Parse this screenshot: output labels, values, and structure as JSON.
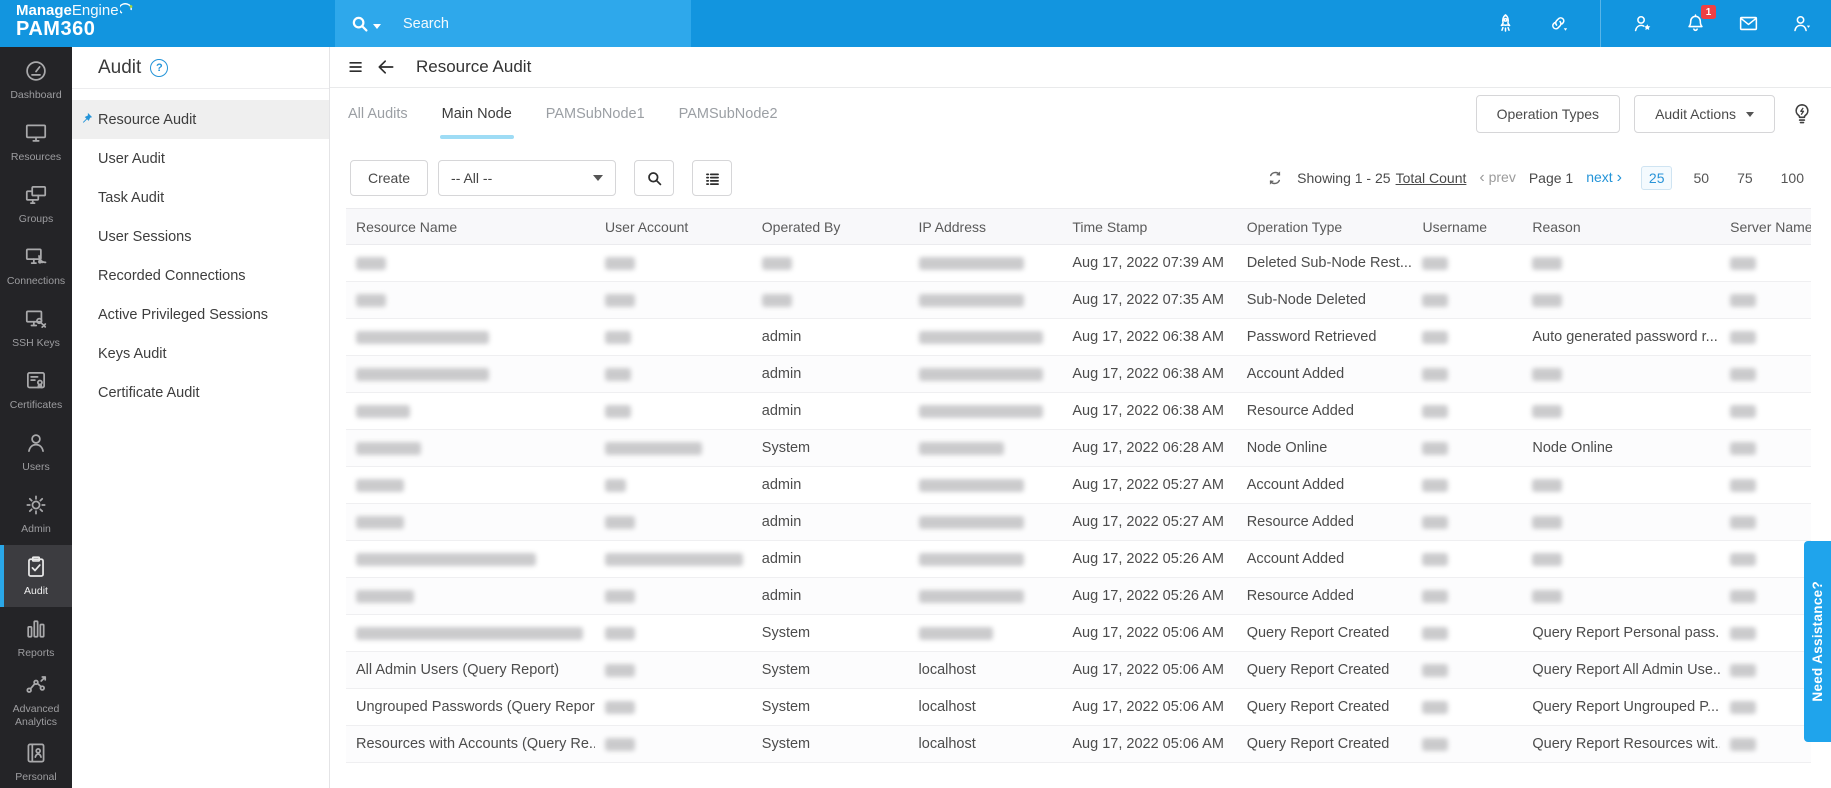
{
  "brand": {
    "manage": "Manage",
    "engine": "Engine",
    "product": "PAM360"
  },
  "topbar": {
    "search_placeholder": "Search",
    "icons": [
      "rocket",
      "link",
      "divider",
      "user-star",
      "bell",
      "mail",
      "user-profile"
    ],
    "notification_badge": "1"
  },
  "sidebar": {
    "items": [
      {
        "label": "Dashboard",
        "icon": "dashboard",
        "active": false
      },
      {
        "label": "Resources",
        "icon": "resources",
        "active": false
      },
      {
        "label": "Groups",
        "icon": "groups",
        "active": false
      },
      {
        "label": "Connections",
        "icon": "connections",
        "active": false
      },
      {
        "label": "SSH Keys",
        "icon": "ssh-keys",
        "active": false
      },
      {
        "label": "Certificates",
        "icon": "certificates",
        "active": false
      },
      {
        "label": "Users",
        "icon": "users",
        "active": false
      },
      {
        "label": "Admin",
        "icon": "admin",
        "active": false
      },
      {
        "label": "Audit",
        "icon": "audit",
        "active": true
      },
      {
        "label": "Reports",
        "icon": "reports",
        "active": false
      },
      {
        "label": "Advanced Analytics",
        "icon": "advanced-analytics",
        "active": false
      },
      {
        "label": "Personal",
        "icon": "personal",
        "active": false
      }
    ]
  },
  "submenu": {
    "title": "Audit",
    "items": [
      {
        "label": "Resource Audit",
        "active": true
      },
      {
        "label": "User Audit",
        "active": false
      },
      {
        "label": "Task Audit",
        "active": false
      },
      {
        "label": "User Sessions",
        "active": false
      },
      {
        "label": "Recorded Connections",
        "active": false
      },
      {
        "label": "Active Privileged Sessions",
        "active": false
      },
      {
        "label": "Keys Audit",
        "active": false
      },
      {
        "label": "Certificate Audit",
        "active": false
      }
    ]
  },
  "page": {
    "title": "Resource Audit"
  },
  "tabs": [
    {
      "label": "All Audits",
      "active": false
    },
    {
      "label": "Main Node",
      "active": true
    },
    {
      "label": "PAMSubNode1",
      "active": false
    },
    {
      "label": "PAMSubNode2",
      "active": false
    }
  ],
  "actions": {
    "operation_types": "Operation Types",
    "audit_actions": "Audit Actions"
  },
  "toolbar": {
    "create_label": "Create",
    "filter_value": "-- All --"
  },
  "pagination": {
    "showing": "Showing 1 - 25",
    "total_count": "Total Count",
    "prev": "prev",
    "page": "Page 1",
    "next": "next",
    "sizes": [
      "25",
      "50",
      "75",
      "100"
    ],
    "active_size": "25"
  },
  "table": {
    "columns": [
      "Resource Name",
      "User Account",
      "Operated By",
      "IP Address",
      "Time Stamp",
      "Operation Type",
      "Username",
      "Reason",
      "Server Name"
    ],
    "rows": [
      [
        {
          "b": 30
        },
        {
          "b": 30
        },
        {
          "b": 30
        },
        {
          "b": 105
        },
        {
          "t": "Aug 17, 2022 07:39 AM"
        },
        {
          "t": "Deleted Sub-Node Rest..."
        },
        {
          "b": 26
        },
        {
          "b": 30
        },
        {
          "b": 26
        }
      ],
      [
        {
          "b": 30
        },
        {
          "b": 30
        },
        {
          "b": 30
        },
        {
          "b": 105
        },
        {
          "t": "Aug 17, 2022 07:35 AM"
        },
        {
          "t": "Sub-Node Deleted"
        },
        {
          "b": 26
        },
        {
          "b": 30
        },
        {
          "b": 26
        }
      ],
      [
        {
          "b": 133
        },
        {
          "b": 26
        },
        {
          "t": "admin"
        },
        {
          "b": 124
        },
        {
          "t": "Aug 17, 2022 06:38 AM"
        },
        {
          "t": "Password Retrieved"
        },
        {
          "b": 26
        },
        {
          "t": "Auto generated password r..."
        },
        {
          "b": 26
        }
      ],
      [
        {
          "b": 133
        },
        {
          "b": 26
        },
        {
          "t": "admin"
        },
        {
          "b": 124
        },
        {
          "t": "Aug 17, 2022 06:38 AM"
        },
        {
          "t": "Account Added"
        },
        {
          "b": 26
        },
        {
          "b": 30
        },
        {
          "b": 26
        }
      ],
      [
        {
          "b": 54
        },
        {
          "b": 26
        },
        {
          "t": "admin"
        },
        {
          "b": 124
        },
        {
          "t": "Aug 17, 2022 06:38 AM"
        },
        {
          "t": "Resource Added"
        },
        {
          "b": 26
        },
        {
          "b": 30
        },
        {
          "b": 26
        }
      ],
      [
        {
          "b": 65
        },
        {
          "b": 97
        },
        {
          "t": "System"
        },
        {
          "b": 85
        },
        {
          "t": "Aug 17, 2022 06:28 AM"
        },
        {
          "t": "Node Online"
        },
        {
          "b": 26
        },
        {
          "t": "Node Online"
        },
        {
          "b": 26
        }
      ],
      [
        {
          "b": 48
        },
        {
          "b": 21
        },
        {
          "t": "admin"
        },
        {
          "b": 105
        },
        {
          "t": "Aug 17, 2022 05:27 AM"
        },
        {
          "t": "Account Added"
        },
        {
          "b": 26
        },
        {
          "b": 30
        },
        {
          "b": 26
        }
      ],
      [
        {
          "b": 48
        },
        {
          "b": 30
        },
        {
          "t": "admin"
        },
        {
          "b": 105
        },
        {
          "t": "Aug 17, 2022 05:27 AM"
        },
        {
          "t": "Resource Added"
        },
        {
          "b": 26
        },
        {
          "b": 30
        },
        {
          "b": 26
        }
      ],
      [
        {
          "b": 180
        },
        {
          "b": 138
        },
        {
          "t": "admin"
        },
        {
          "b": 105
        },
        {
          "t": "Aug 17, 2022 05:26 AM"
        },
        {
          "t": "Account Added"
        },
        {
          "b": 26
        },
        {
          "b": 30
        },
        {
          "b": 26
        }
      ],
      [
        {
          "b": 58
        },
        {
          "b": 30
        },
        {
          "t": "admin"
        },
        {
          "b": 105
        },
        {
          "t": "Aug 17, 2022 05:26 AM"
        },
        {
          "t": "Resource Added"
        },
        {
          "b": 26
        },
        {
          "b": 30
        },
        {
          "b": 26
        }
      ],
      [
        {
          "b": 227
        },
        {
          "b": 30
        },
        {
          "t": "System"
        },
        {
          "b": 74
        },
        {
          "t": "Aug 17, 2022 05:06 AM"
        },
        {
          "t": "Query Report Created"
        },
        {
          "b": 26
        },
        {
          "t": "Query Report Personal pass..."
        },
        {
          "b": 26
        }
      ],
      [
        {
          "t": "All Admin Users (Query Report)"
        },
        {
          "b": 30
        },
        {
          "t": "System"
        },
        {
          "t": "localhost"
        },
        {
          "t": "Aug 17, 2022 05:06 AM"
        },
        {
          "t": "Query Report Created"
        },
        {
          "b": 26
        },
        {
          "t": "Query Report All Admin Use..."
        },
        {
          "b": 26
        }
      ],
      [
        {
          "t": "Ungrouped Passwords (Query Report)"
        },
        {
          "b": 30
        },
        {
          "t": "System"
        },
        {
          "t": "localhost"
        },
        {
          "t": "Aug 17, 2022 05:06 AM"
        },
        {
          "t": "Query Report Created"
        },
        {
          "b": 26
        },
        {
          "t": "Query Report Ungrouped P..."
        },
        {
          "b": 26
        }
      ],
      [
        {
          "t": "Resources with Accounts (Query Re..."
        },
        {
          "b": 30
        },
        {
          "t": "System"
        },
        {
          "t": "localhost"
        },
        {
          "t": "Aug 17, 2022 05:06 AM"
        },
        {
          "t": "Query Report Created"
        },
        {
          "b": 26
        },
        {
          "t": "Query Report Resources wit..."
        },
        {
          "b": 26
        }
      ]
    ]
  },
  "assistance": {
    "label": "Need Assistance?"
  }
}
